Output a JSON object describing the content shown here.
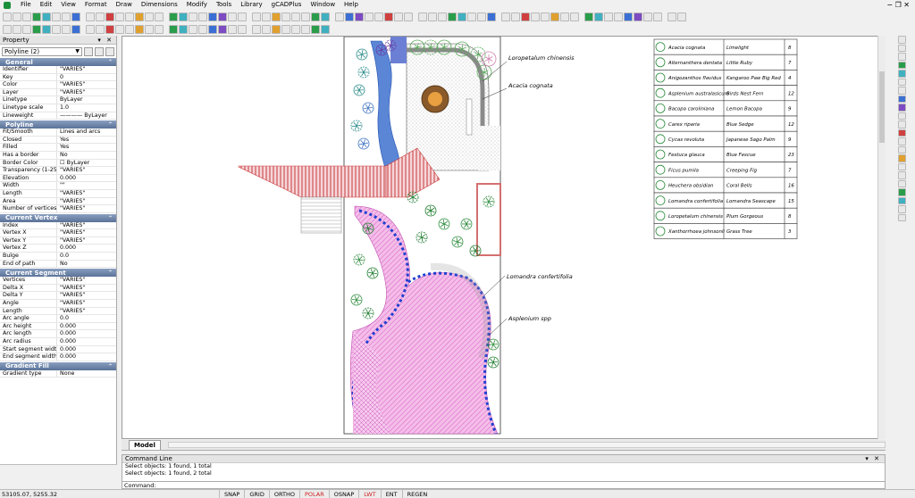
{
  "menu": [
    "File",
    "Edit",
    "View",
    "Format",
    "Draw",
    "Dimensions",
    "Modify",
    "Tools",
    "Library",
    "gCADPlus",
    "Window",
    "Help"
  ],
  "window_controls": "− ❐ ✕",
  "property_panel": {
    "title": "Property",
    "title_controls": "▾ ✕",
    "selection": "Polyline (2)",
    "sections": [
      {
        "name": "General",
        "rows": [
          [
            "Identifier",
            "\"VARIES\""
          ],
          [
            "Key",
            "0"
          ],
          [
            "Color",
            "\"VARIES\""
          ],
          [
            "Layer",
            "\"VARIES\""
          ],
          [
            "Linetype",
            "ByLayer"
          ],
          [
            "Linetype scale",
            "1.0"
          ],
          [
            "Lineweight",
            "———— ByLayer"
          ]
        ]
      },
      {
        "name": "Polyline",
        "rows": [
          [
            "Fit/Smooth",
            "Lines and arcs"
          ],
          [
            "Closed",
            "Yes"
          ],
          [
            "Filled",
            "Yes"
          ],
          [
            "Has a border",
            "No"
          ],
          [
            "Border Color",
            "☐ ByLayer"
          ],
          [
            "Transparency (1-255)",
            "\"VARIES\""
          ],
          [
            "Elevation",
            "0.000"
          ],
          [
            "Width",
            "\"\""
          ],
          [
            "Length",
            "\"VARIES\""
          ],
          [
            "Area",
            "\"VARIES\""
          ],
          [
            "Number of vertices",
            "\"VARIES\""
          ]
        ]
      },
      {
        "name": "Current Vertex",
        "rows": [
          [
            "Index",
            "\"VARIES\""
          ],
          [
            "Vertex X",
            "\"VARIES\""
          ],
          [
            "Vertex Y",
            "\"VARIES\""
          ],
          [
            "Vertex Z",
            "0.000"
          ],
          [
            "Bulge",
            "0.0"
          ],
          [
            "End of path",
            "No"
          ]
        ]
      },
      {
        "name": "Current Segment",
        "rows": [
          [
            "Vertices",
            "\"VARIES\""
          ],
          [
            "Delta X",
            "\"VARIES\""
          ],
          [
            "Delta Y",
            "\"VARIES\""
          ],
          [
            "Angle",
            "\"VARIES\""
          ],
          [
            "Length",
            "\"VARIES\""
          ],
          [
            "Arc angle",
            "0.0"
          ],
          [
            "Arc height",
            "0.000"
          ],
          [
            "Arc length",
            "0.000"
          ],
          [
            "Arc radius",
            "0.000"
          ],
          [
            "Start segment width",
            "0.000"
          ],
          [
            "End segment width",
            "0.000"
          ]
        ]
      },
      {
        "name": "Gradient Fill",
        "rows": [
          [
            "Gradient type",
            "None"
          ]
        ]
      }
    ]
  },
  "drawing": {
    "labels": [
      "Loropetalum chinensis",
      "Acacia cognata",
      "Lomandra confertifolia",
      "Asplenium spp"
    ]
  },
  "plant_schedule": [
    [
      "Acacia cognata",
      "Limelight",
      "8"
    ],
    [
      "Alternanthera dentata",
      "Little Ruby",
      "7"
    ],
    [
      "Anigozanthos flavidus",
      "Kangaroo Paw Big Red",
      "4"
    ],
    [
      "Asplenium australasicum",
      "Birds Nest Fern",
      "12"
    ],
    [
      "Bacopa caroliniana",
      "Lemon Bacopa",
      "9"
    ],
    [
      "Carex riparia",
      "Blue Sedge",
      "12"
    ],
    [
      "Cycas revoluta",
      "Japanese Sago Palm",
      "9"
    ],
    [
      "Festuca glauca",
      "Blue Fescue",
      "23"
    ],
    [
      "Ficus pumila",
      "Creeping Fig",
      "7"
    ],
    [
      "Heuchera obsidian",
      "Coral Bells",
      "16"
    ],
    [
      "Lomandra confertifolia",
      "Lomandra Seascape",
      "15"
    ],
    [
      "Loropetalum chinensis",
      "Plum Gorgeous",
      "8"
    ],
    [
      "Xanthorrhoea johnsonii",
      "Grass Tree",
      "3"
    ]
  ],
  "tabs": [
    "Model"
  ],
  "command": {
    "title": "Command Line",
    "title_controls": "▾ ✕",
    "history": [
      "Select objects: 1 found,  1 total",
      "Select objects: 1 found,  2 total"
    ],
    "prompt": "Command:"
  },
  "status": {
    "coords": "53105.07,  5255.32",
    "buttons": [
      "SNAP",
      "GRID",
      "ORTHO",
      "POLAR",
      "OSNAP",
      "LWT",
      "ENT",
      "REGEN"
    ],
    "active": [
      "POLAR",
      "LWT"
    ]
  },
  "colors": {
    "paving": "#e0a6b2",
    "lawn": "#e892d6",
    "water": "#5b86d6",
    "edge": "#1f3fd0",
    "deck": "#c73a3a"
  }
}
